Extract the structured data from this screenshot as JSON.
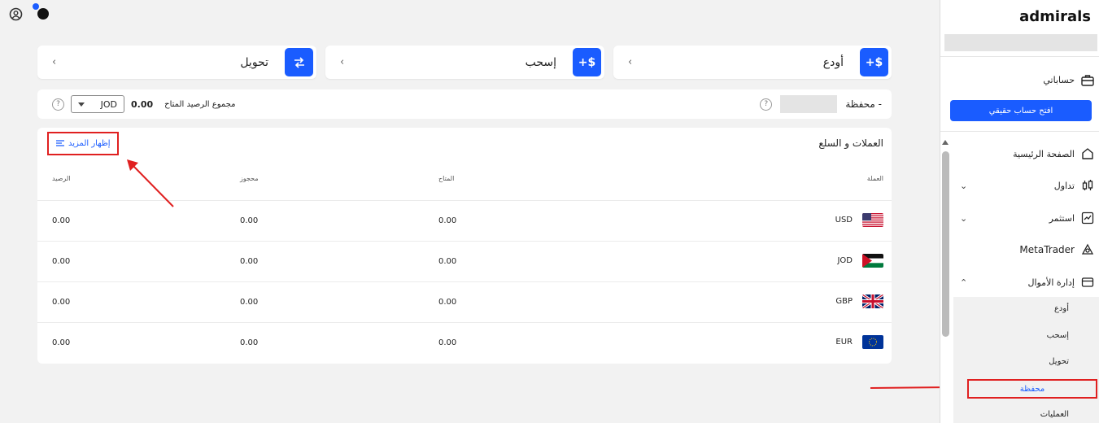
{
  "top": {
    "icons": [
      "user-circle-icon",
      "notification-icon"
    ]
  },
  "actions": [
    {
      "label": "أودع",
      "icon": "deposit-icon",
      "btn_glyph": "+$"
    },
    {
      "label": "إسحب",
      "icon": "withdraw-icon",
      "btn_glyph": "+$"
    },
    {
      "label": "تحويل",
      "icon": "transfer-icon",
      "btn_glyph": "⇄"
    }
  ],
  "wallet": {
    "name_label": "محفظة -",
    "total_label": "مجموع الرصيد المتاح",
    "total_amount": "0.00",
    "currency": "JOD"
  },
  "table": {
    "title": "العملات و السلع",
    "show_more": "إظهار المزيد",
    "columns": {
      "currency": "العملة",
      "available": "المتاح",
      "reserved": "محجوز",
      "balance": "الرصيد"
    },
    "rows": [
      {
        "currency": "USD",
        "flag": "us-flag",
        "available": "0.00",
        "reserved": "0.00",
        "balance": "0.00"
      },
      {
        "currency": "JOD",
        "flag": "jo-flag",
        "available": "0.00",
        "reserved": "0.00",
        "balance": "0.00"
      },
      {
        "currency": "GBP",
        "flag": "gb-flag",
        "available": "0.00",
        "reserved": "0.00",
        "balance": "0.00"
      },
      {
        "currency": "EUR",
        "flag": "eu-flag",
        "available": "0.00",
        "reserved": "0.00",
        "balance": "0.00"
      }
    ]
  },
  "sidebar": {
    "logo": "admirals",
    "accounts": "حساباتي",
    "open_account": "افتح حساب حقيقي",
    "items": [
      {
        "label": "الصفحة الرئيسية",
        "icon": "home-icon"
      },
      {
        "label": "تداول",
        "icon": "candlestick-icon"
      },
      {
        "label": "استثمر",
        "icon": "chart-icon"
      },
      {
        "label": "MetaTrader",
        "icon": "metatrader-icon"
      },
      {
        "label": "إدارة الأموال",
        "icon": "wallet-icon"
      }
    ],
    "submenu": [
      "أودع",
      "إسحب",
      "تحويل",
      "محفظة",
      "العمليات"
    ]
  },
  "colors": {
    "accent": "#1a5cff",
    "annotation": "#e02020"
  }
}
